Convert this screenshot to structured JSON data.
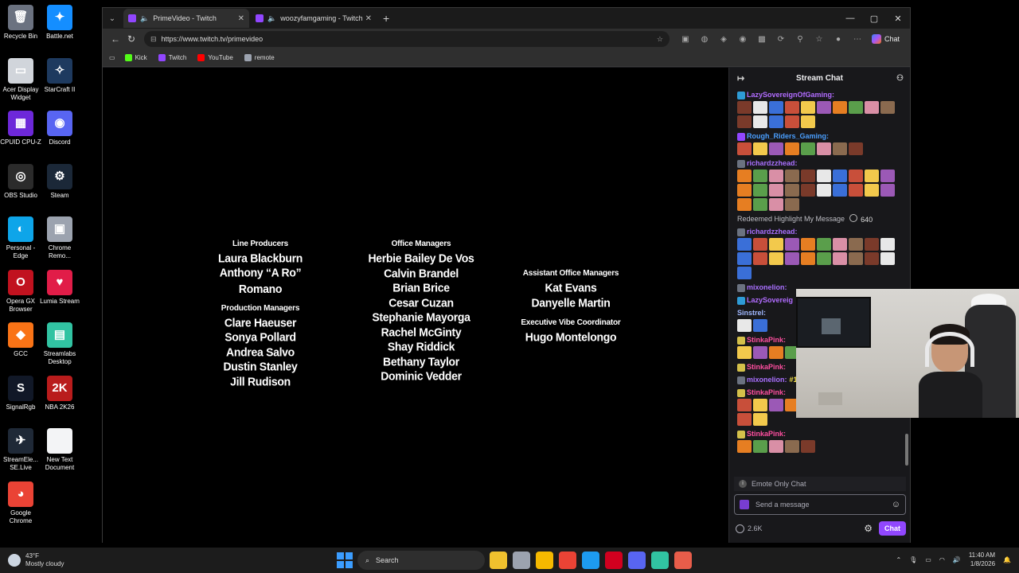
{
  "desktop_icons": [
    {
      "label": "Recycle Bin",
      "color": "#6b7280",
      "glyph": "🗑",
      "icon": "recycle-bin-icon"
    },
    {
      "label": "Battle.net",
      "color": "#148eff",
      "glyph": "✦",
      "icon": "battlenet-icon"
    },
    {
      "label": "Acer Display Widget",
      "color": "#d1d5db",
      "glyph": "▭",
      "icon": "acer-widget-icon"
    },
    {
      "label": "StarCraft II",
      "color": "#1e3a5f",
      "glyph": "✧",
      "icon": "starcraft-icon"
    },
    {
      "label": "CPUID CPU-Z",
      "color": "#6d28d9",
      "glyph": "▦",
      "icon": "cpuz-icon"
    },
    {
      "label": "Discord",
      "color": "#5865f2",
      "glyph": "◉",
      "icon": "discord-icon"
    },
    {
      "label": "OBS Studio",
      "color": "#2b2b2b",
      "glyph": "◎",
      "icon": "obs-icon"
    },
    {
      "label": "Steam",
      "color": "#1b2838",
      "glyph": "⚙",
      "icon": "steam-icon"
    },
    {
      "label": "Personal - Edge",
      "color": "#0ea5e9",
      "glyph": "◐",
      "icon": "edge-icon"
    },
    {
      "label": "Chrome Remo...",
      "color": "#9ca3af",
      "glyph": "▣",
      "icon": "chrome-remote-icon"
    },
    {
      "label": "Opera GX Browser",
      "color": "#c1121f",
      "glyph": "O",
      "icon": "opera-gx-icon"
    },
    {
      "label": "Lumia Stream",
      "color": "#e11d48",
      "glyph": "♥",
      "icon": "lumia-icon"
    },
    {
      "label": "GCC",
      "color": "#f97316",
      "glyph": "◆",
      "icon": "gcc-icon"
    },
    {
      "label": "Streamlabs Desktop",
      "color": "#31c3a2",
      "glyph": "▤",
      "icon": "streamlabs-icon"
    },
    {
      "label": "SignalRgb",
      "color": "#111827",
      "glyph": "S",
      "icon": "signalrgb-icon"
    },
    {
      "label": "NBA 2K26",
      "color": "#b91c1c",
      "glyph": "2K",
      "icon": "nba2k-icon"
    },
    {
      "label": "StreamEle... SE.Live",
      "color": "#1f2937",
      "glyph": "✈",
      "icon": "streamelements-icon"
    },
    {
      "label": "New Text Document",
      "color": "#f3f4f6",
      "glyph": "",
      "icon": "text-document-icon"
    },
    {
      "label": "Google Chrome",
      "color": "#ea4335",
      "glyph": "◕",
      "icon": "chrome-icon"
    }
  ],
  "browser": {
    "tabs": [
      {
        "title": "PrimeVideo - Twitch",
        "active": true
      },
      {
        "title": "woozyfamgaming - Twitch",
        "active": false
      }
    ],
    "url": "https://www.twitch.tv/primevideo",
    "chat_button": "Chat",
    "bookmarks": [
      {
        "label": "Kick",
        "color": "#53fc18"
      },
      {
        "label": "Twitch",
        "color": "#9146ff"
      },
      {
        "label": "YouTube",
        "color": "#ff0000"
      },
      {
        "label": "remote",
        "color": "#9ca3af"
      }
    ]
  },
  "credits": {
    "col1": [
      {
        "role": "Line Producers",
        "names": [
          "Laura Blackburn",
          "Anthony “A Ro” Romano"
        ]
      },
      {
        "role": "Production Managers",
        "names": [
          "Clare Haeuser",
          "Sonya Pollard",
          "Andrea Salvo",
          "Dustin Stanley",
          "Jill Rudison"
        ]
      }
    ],
    "col2": [
      {
        "role": "Office Managers",
        "names": [
          "Herbie Bailey De Vos",
          "Calvin Brandel",
          "Brian Brice",
          "Cesar Cuzan",
          "Stephanie Mayorga",
          "Rachel McGinty",
          "Shay Riddick",
          "Bethany Taylor",
          "Dominic Vedder"
        ]
      }
    ],
    "col3": [
      {
        "role": "Assistant Office Managers",
        "names": [
          "Kat Evans",
          "Danyelle Martin"
        ]
      },
      {
        "role": "Executive Vibe Coordinator",
        "names": [
          "Hugo Montelongo"
        ]
      }
    ]
  },
  "chat": {
    "title": "Stream Chat",
    "messages": [
      {
        "user": "LazySovereignOfGaming:",
        "color": "#b16cff",
        "badge": "#2e9bd6",
        "emotes": 15,
        "text": ""
      },
      {
        "user": "Rough_Riders_Gaming:",
        "color": "#4a9fff",
        "badge": "#9147ff",
        "emotes": 8,
        "text": ""
      },
      {
        "user": "richardzzhead:",
        "color": "#a970ff",
        "badge": "#6b7280",
        "emotes": 24,
        "text": ""
      },
      {
        "redeem": "Redeemed Highlight My Message",
        "points": "640"
      },
      {
        "user": "richardzzhead:",
        "color": "#a970ff",
        "badge": "#6b7280",
        "emotes": 21,
        "text": ""
      },
      {
        "user": "mixonelion:",
        "color": "#a970ff",
        "badge": "#6b7280",
        "emotes": 0,
        "text": ""
      },
      {
        "user": "LazySovereig",
        "color": "#b16cff",
        "badge": "#2e9bd6",
        "emotes": 0,
        "text": ""
      },
      {
        "user": "Sinstrel:",
        "color": "#a0b8ff",
        "badge": "",
        "emotes": 2,
        "text": ""
      },
      {
        "user": "StinkaPink:",
        "color": "#ff4fa0",
        "badge": "#d4c04a",
        "emotes": 5,
        "text": ""
      },
      {
        "user": "StinkaPink:",
        "color": "#ff4fa0",
        "badge": "#d4c04a",
        "emotes": 0,
        "text": ""
      },
      {
        "user": "mixonelion:",
        "color": "#a970ff",
        "badge": "#6b7280",
        "emotes": 0,
        "text": "#1 #1 #1 #1 #1"
      },
      {
        "user": "StinkaPink:",
        "color": "#ff4fa0",
        "badge": "#d4c04a",
        "emotes": 12,
        "text": ""
      },
      {
        "user": "StinkaPink:",
        "color": "#ff4fa0",
        "badge": "#d4c04a",
        "emotes": 5,
        "text": ""
      }
    ],
    "emote_only": "Emote Only Chat",
    "input_placeholder": "Send a message",
    "points": "2.6K",
    "send_label": "Chat"
  },
  "taskbar": {
    "weather_temp": "43°F",
    "weather_desc": "Mostly cloudy",
    "search_label": "Search",
    "apps": [
      "#f0c12e",
      "#9ca3af",
      "#f6b900",
      "#ea4335",
      "#1d9bf0",
      "#d1001f",
      "#5865f2",
      "#31c3a2",
      "#e85d4a"
    ],
    "time": "11:40 AM",
    "date": "1/8/2026"
  }
}
